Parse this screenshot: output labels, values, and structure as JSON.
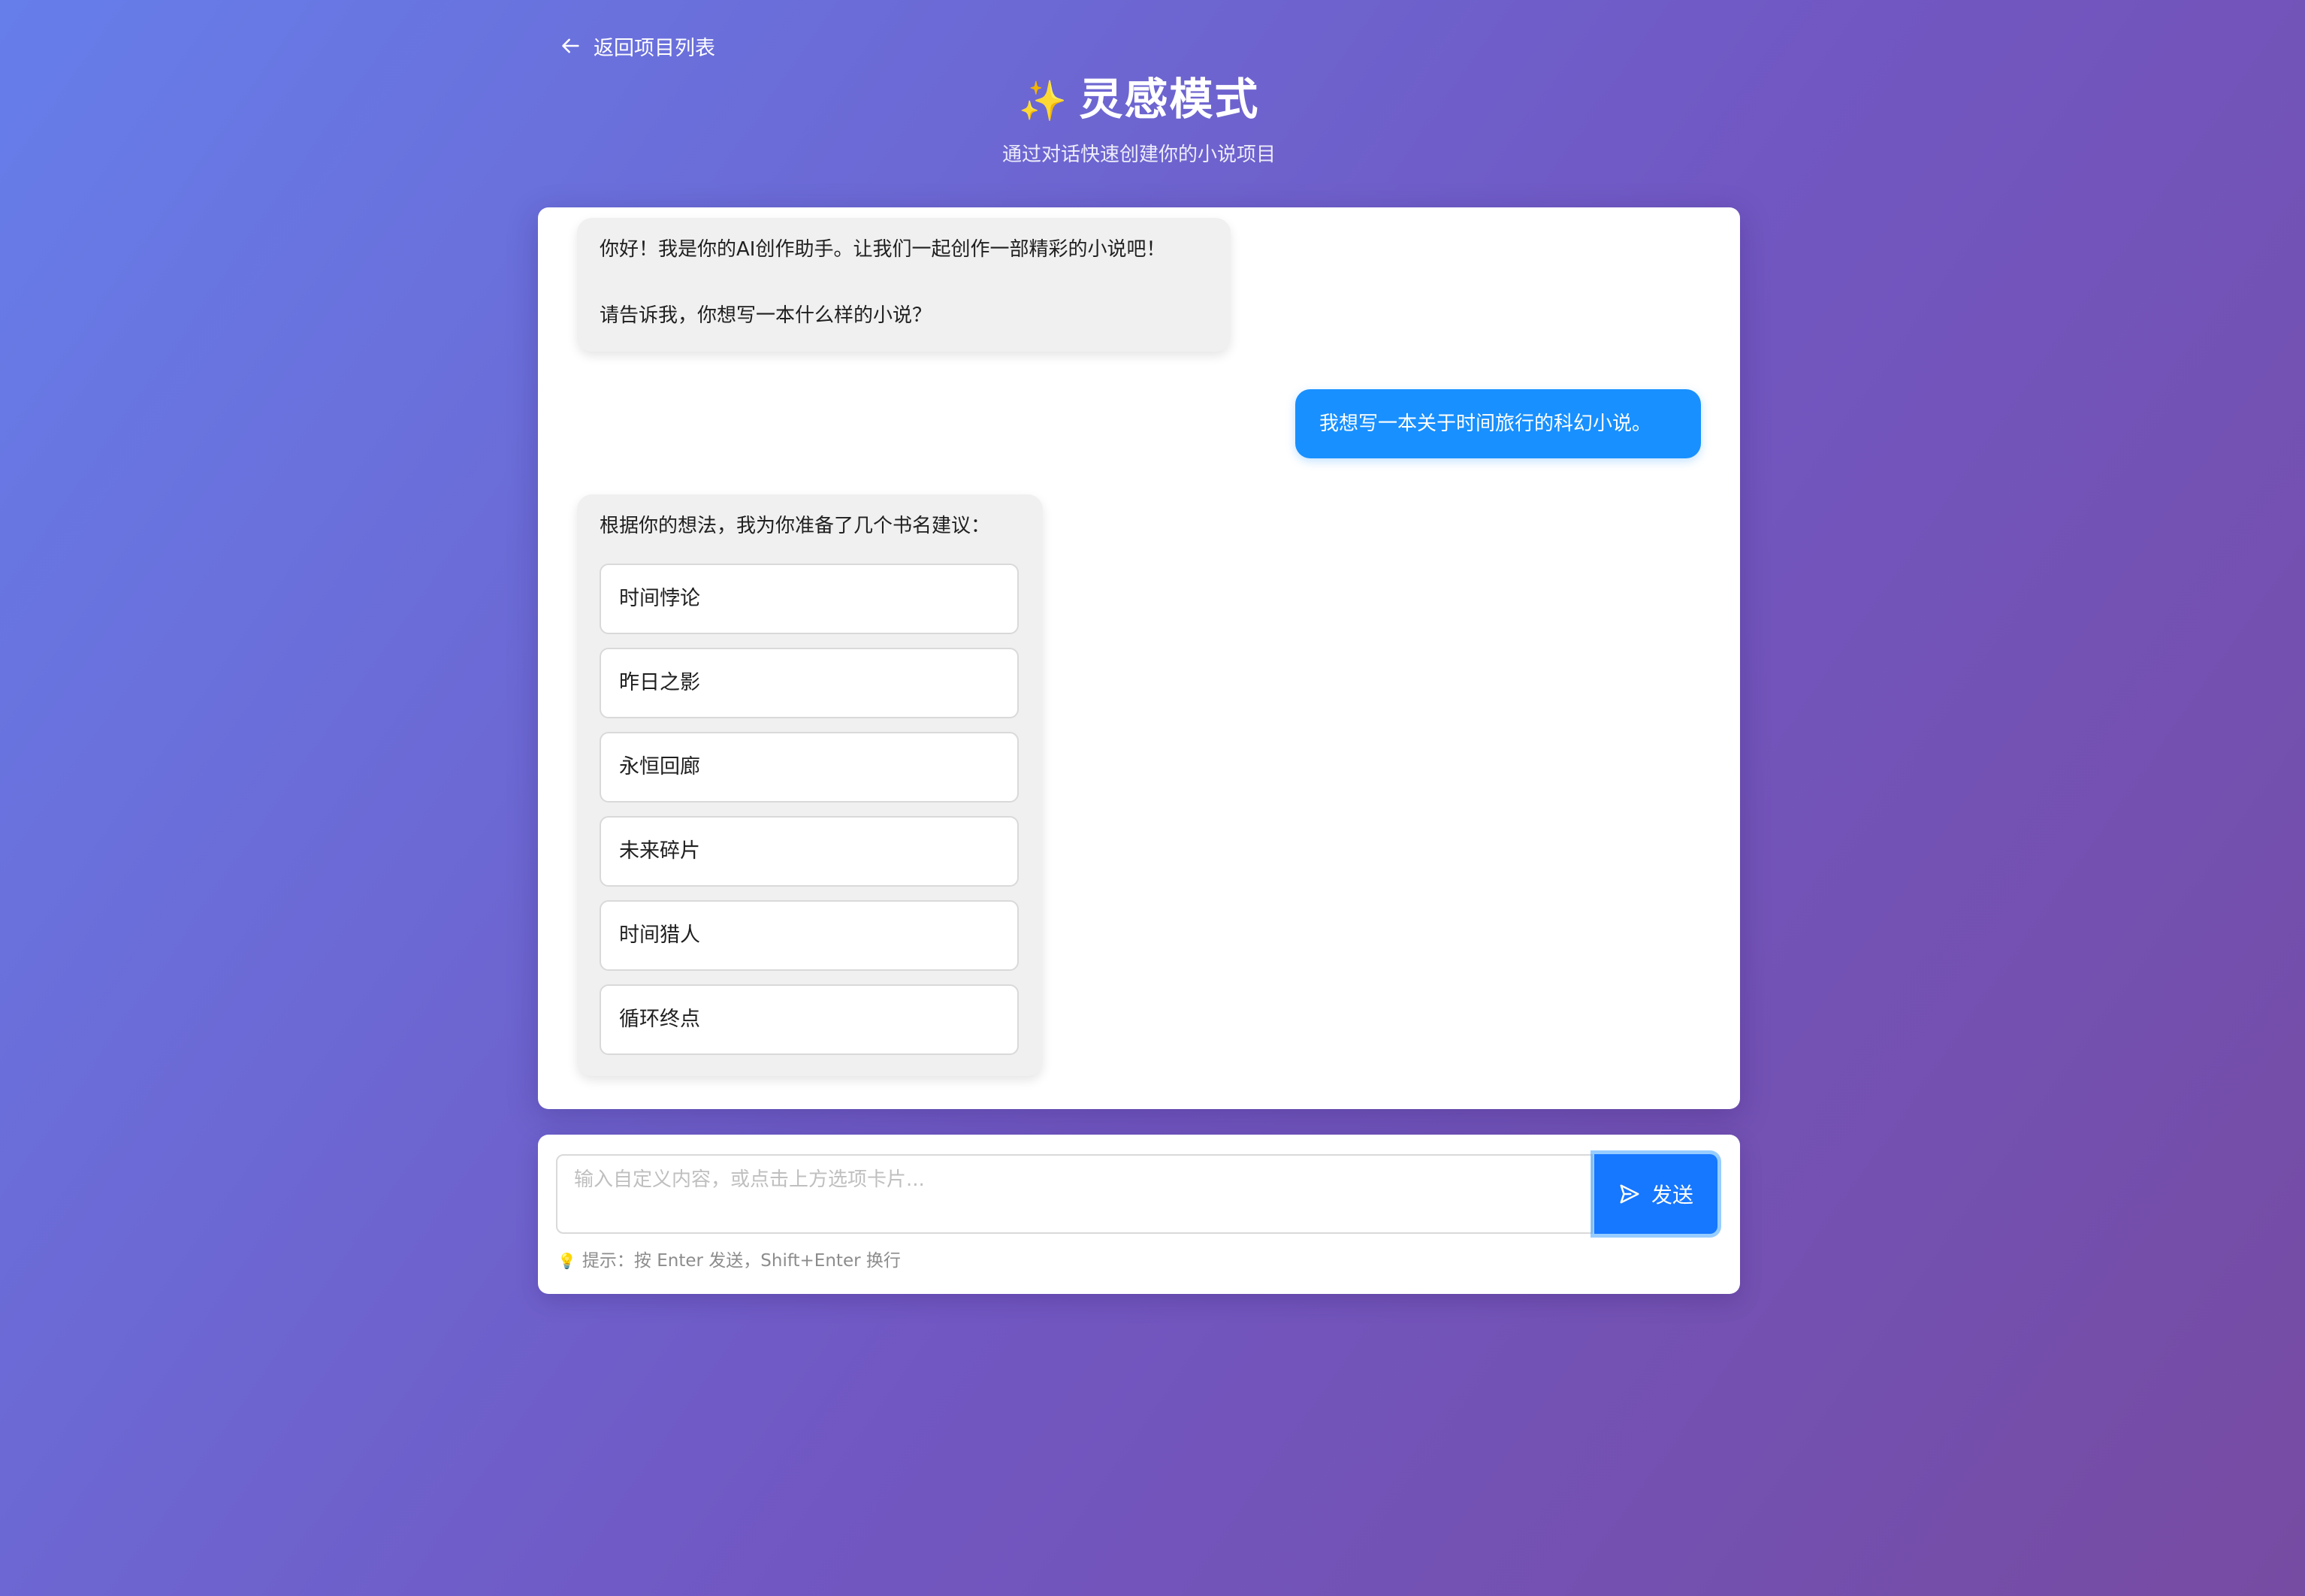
{
  "header": {
    "back_label": "返回项目列表",
    "title": "灵感模式",
    "title_icon": "✨",
    "subtitle": "通过对话快速创建你的小说项目"
  },
  "messages": {
    "greeting_line1": "你好！我是你的AI创作助手。让我们一起创作一部精彩的小说吧！",
    "greeting_line2": "请告诉我，你想写一本什么样的小说？",
    "user_reply": "我想写一本关于时间旅行的科幻小说。",
    "suggestion_intro": "根据你的想法，我为你准备了几个书名建议："
  },
  "suggestions": [
    "时间悖论",
    "昨日之影",
    "永恒回廊",
    "未来碎片",
    "时间猎人",
    "循环终点"
  ],
  "composer": {
    "placeholder": "输入自定义内容，或点击上方选项卡片...",
    "send_label": "发送",
    "hint": "提示：按 Enter 发送，Shift+Enter 换行"
  },
  "colors": {
    "background_start": "#667eea",
    "background_end": "#764ba2",
    "user_bubble": "#1890ff",
    "send_button": "#1677ff",
    "ai_bubble": "#f0f0f0"
  }
}
